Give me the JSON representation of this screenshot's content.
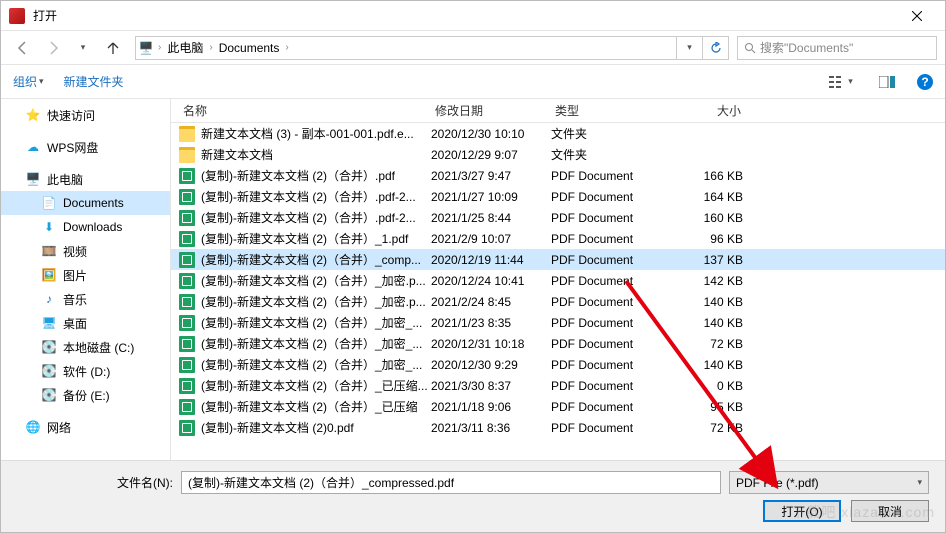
{
  "title": "打开",
  "breadcrumb": {
    "root_icon": "pc",
    "segments": [
      "此电脑",
      "Documents"
    ]
  },
  "search": {
    "placeholder": "搜索\"Documents\""
  },
  "toolbar": {
    "organize": "组织",
    "newfolder": "新建文件夹"
  },
  "sidebar": {
    "quick": "快速访问",
    "wps": "WPS网盘",
    "thispc": "此电脑",
    "documents": "Documents",
    "downloads": "Downloads",
    "videos": "视频",
    "pictures": "图片",
    "music": "音乐",
    "desktop": "桌面",
    "diskc": "本地磁盘 (C:)",
    "diskd": "软件 (D:)",
    "diske": "备份 (E:)",
    "network": "网络"
  },
  "columns": {
    "name": "名称",
    "date": "修改日期",
    "type": "类型",
    "size": "大小"
  },
  "file_label": "文件名(N):",
  "file_value": "(复制)-新建文本文档 (2)（合并）_compressed.pdf",
  "filter": "PDF File (*.pdf)",
  "buttons": {
    "open": "打开(O)",
    "cancel": "取消"
  },
  "rows": [
    {
      "icon": "folder",
      "name": "新建文本文档 (3) - 副本-001-001.pdf.e...",
      "date": "2020/12/30 10:10",
      "type": "文件夹",
      "size": ""
    },
    {
      "icon": "folder",
      "name": "新建文本文档",
      "date": "2020/12/29 9:07",
      "type": "文件夹",
      "size": ""
    },
    {
      "icon": "pdf",
      "name": "(复制)-新建文本文档 (2)（合并）.pdf",
      "date": "2021/3/27 9:47",
      "type": "PDF Document",
      "size": "166 KB"
    },
    {
      "icon": "pdf",
      "name": "(复制)-新建文本文档 (2)（合并）.pdf-2...",
      "date": "2021/1/27 10:09",
      "type": "PDF Document",
      "size": "164 KB"
    },
    {
      "icon": "pdf",
      "name": "(复制)-新建文本文档 (2)（合并）.pdf-2...",
      "date": "2021/1/25 8:44",
      "type": "PDF Document",
      "size": "160 KB"
    },
    {
      "icon": "pdf",
      "name": "(复制)-新建文本文档 (2)（合并）_1.pdf",
      "date": "2021/2/9 10:07",
      "type": "PDF Document",
      "size": "96 KB"
    },
    {
      "icon": "pdf",
      "name": "(复制)-新建文本文档 (2)（合并）_comp...",
      "date": "2020/12/19 11:44",
      "type": "PDF Document",
      "size": "137 KB",
      "selected": true
    },
    {
      "icon": "pdf",
      "name": "(复制)-新建文本文档 (2)（合并）_加密.p...",
      "date": "2020/12/24 10:41",
      "type": "PDF Document",
      "size": "142 KB"
    },
    {
      "icon": "pdf",
      "name": "(复制)-新建文本文档 (2)（合并）_加密.p...",
      "date": "2021/2/24 8:45",
      "type": "PDF Document",
      "size": "140 KB"
    },
    {
      "icon": "pdf",
      "name": "(复制)-新建文本文档 (2)（合并）_加密_...",
      "date": "2021/1/23 8:35",
      "type": "PDF Document",
      "size": "140 KB"
    },
    {
      "icon": "pdf",
      "name": "(复制)-新建文本文档 (2)（合并）_加密_...",
      "date": "2020/12/31 10:18",
      "type": "PDF Document",
      "size": "72 KB"
    },
    {
      "icon": "pdf",
      "name": "(复制)-新建文本文档 (2)（合并）_加密_...",
      "date": "2020/12/30 9:29",
      "type": "PDF Document",
      "size": "140 KB"
    },
    {
      "icon": "pdf",
      "name": "(复制)-新建文本文档 (2)（合并）_已压缩...",
      "date": "2021/3/30 8:37",
      "type": "PDF Document",
      "size": "0 KB"
    },
    {
      "icon": "pdf",
      "name": "(复制)-新建文本文档 (2)（合并）_已压缩",
      "date": "2021/1/18 9:06",
      "type": "PDF Document",
      "size": "95 KB"
    },
    {
      "icon": "pdf",
      "name": "(复制)-新建文本文档 (2)0.pdf",
      "date": "2021/3/11 8:36",
      "type": "PDF Document",
      "size": "72 KB"
    }
  ],
  "watermark": "下载吧 xiazaiba.com"
}
